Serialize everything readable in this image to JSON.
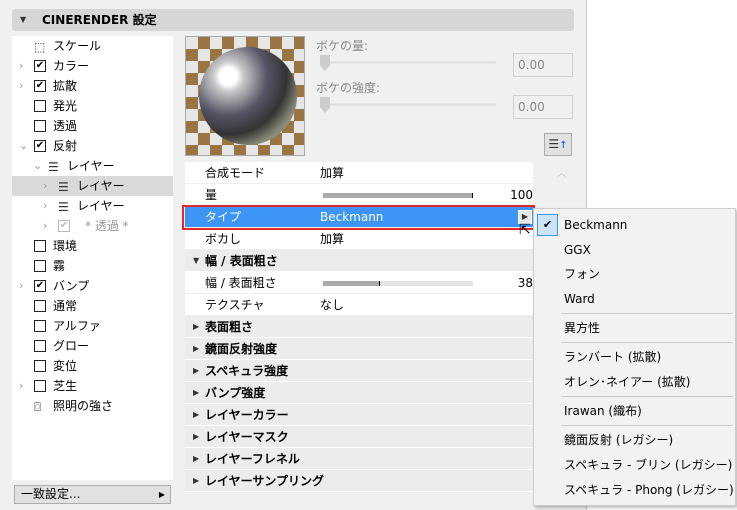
{
  "panel": {
    "title": "CINERENDER 設定"
  },
  "tree": [
    {
      "label": "スケール",
      "icon": "scale-icon"
    },
    {
      "label": "カラー",
      "checked": true,
      "expandable": true
    },
    {
      "label": "拡散",
      "checked": true,
      "expandable": true
    },
    {
      "label": "発光",
      "checked": false
    },
    {
      "label": "透過",
      "checked": false
    },
    {
      "label": "反射",
      "checked": true,
      "expanded": true
    },
    {
      "label": "レイヤー",
      "icon": "layers-icon",
      "expanded": true
    },
    {
      "label": "レイヤー",
      "icon": "layers-icon",
      "selected": true
    },
    {
      "label": "レイヤー",
      "icon": "layers-icon"
    },
    {
      "label": "* 透過 *",
      "checked": true,
      "disabled": true
    },
    {
      "label": "環境",
      "checked": false
    },
    {
      "label": "霧",
      "checked": false
    },
    {
      "label": "バンプ",
      "checked": true,
      "expandable": true
    },
    {
      "label": "通常",
      "checked": false
    },
    {
      "label": "アルファ",
      "checked": false
    },
    {
      "label": "グロー",
      "checked": false
    },
    {
      "label": "変位",
      "checked": false
    },
    {
      "label": "芝生",
      "checked": false,
      "expandable": true
    },
    {
      "label": "照明の強さ",
      "icon": "light-intensity-icon"
    }
  ],
  "match_button": "一致設定...",
  "bokeh": {
    "amount_label": "ボケの量:",
    "amount_value": "0.00",
    "strength_label": "ボケの強度:",
    "strength_value": "0.00"
  },
  "props": {
    "blend_mode": {
      "label": "合成モード",
      "value": "加算"
    },
    "amount": {
      "label": "量",
      "value": "100",
      "fraction": 1.0
    },
    "type": {
      "label": "タイプ",
      "value": "Beckmann"
    },
    "blur": {
      "label": "ボカし",
      "value": "加算"
    },
    "width_group": "幅 / 表面粗さ",
    "width": {
      "label": "幅 / 表面粗さ",
      "value": "38",
      "fraction": 0.38
    },
    "texture": {
      "label": "テクスチャ",
      "value": "なし"
    },
    "groups": [
      "表面粗さ",
      "鏡面反射強度",
      "スペキュラ強度",
      "バンプ強度",
      "レイヤーカラー",
      "レイヤーマスク",
      "レイヤーフレネル",
      "レイヤーサンプリング"
    ]
  },
  "menu": {
    "check": "✔",
    "items": [
      "Beckmann",
      "GGX",
      "フォン",
      "Ward",
      "異方性",
      "ランバート (拡散)",
      "オレン･ネイアー (拡散)",
      "Irawan (織布)",
      "鏡面反射 (レガシー)",
      "スペキュラ - ブリン (レガシー)",
      "スペキュラ - Phong (レガシー)"
    ],
    "selected": "Beckmann"
  }
}
